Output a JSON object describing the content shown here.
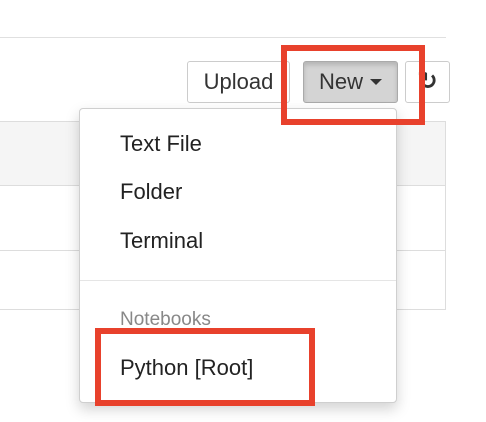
{
  "toolbar": {
    "upload_label": "Upload",
    "new_label": "New",
    "refresh_icon": "refresh-icon"
  },
  "new_menu": {
    "items": [
      {
        "label": "Text File"
      },
      {
        "label": "Folder"
      },
      {
        "label": "Terminal"
      }
    ],
    "notebooks_header": "Notebooks",
    "notebooks": [
      {
        "label": "Python [Root]"
      }
    ]
  },
  "colors": {
    "highlight": "#e8412c",
    "new_button_active": "#d4d4d4"
  }
}
